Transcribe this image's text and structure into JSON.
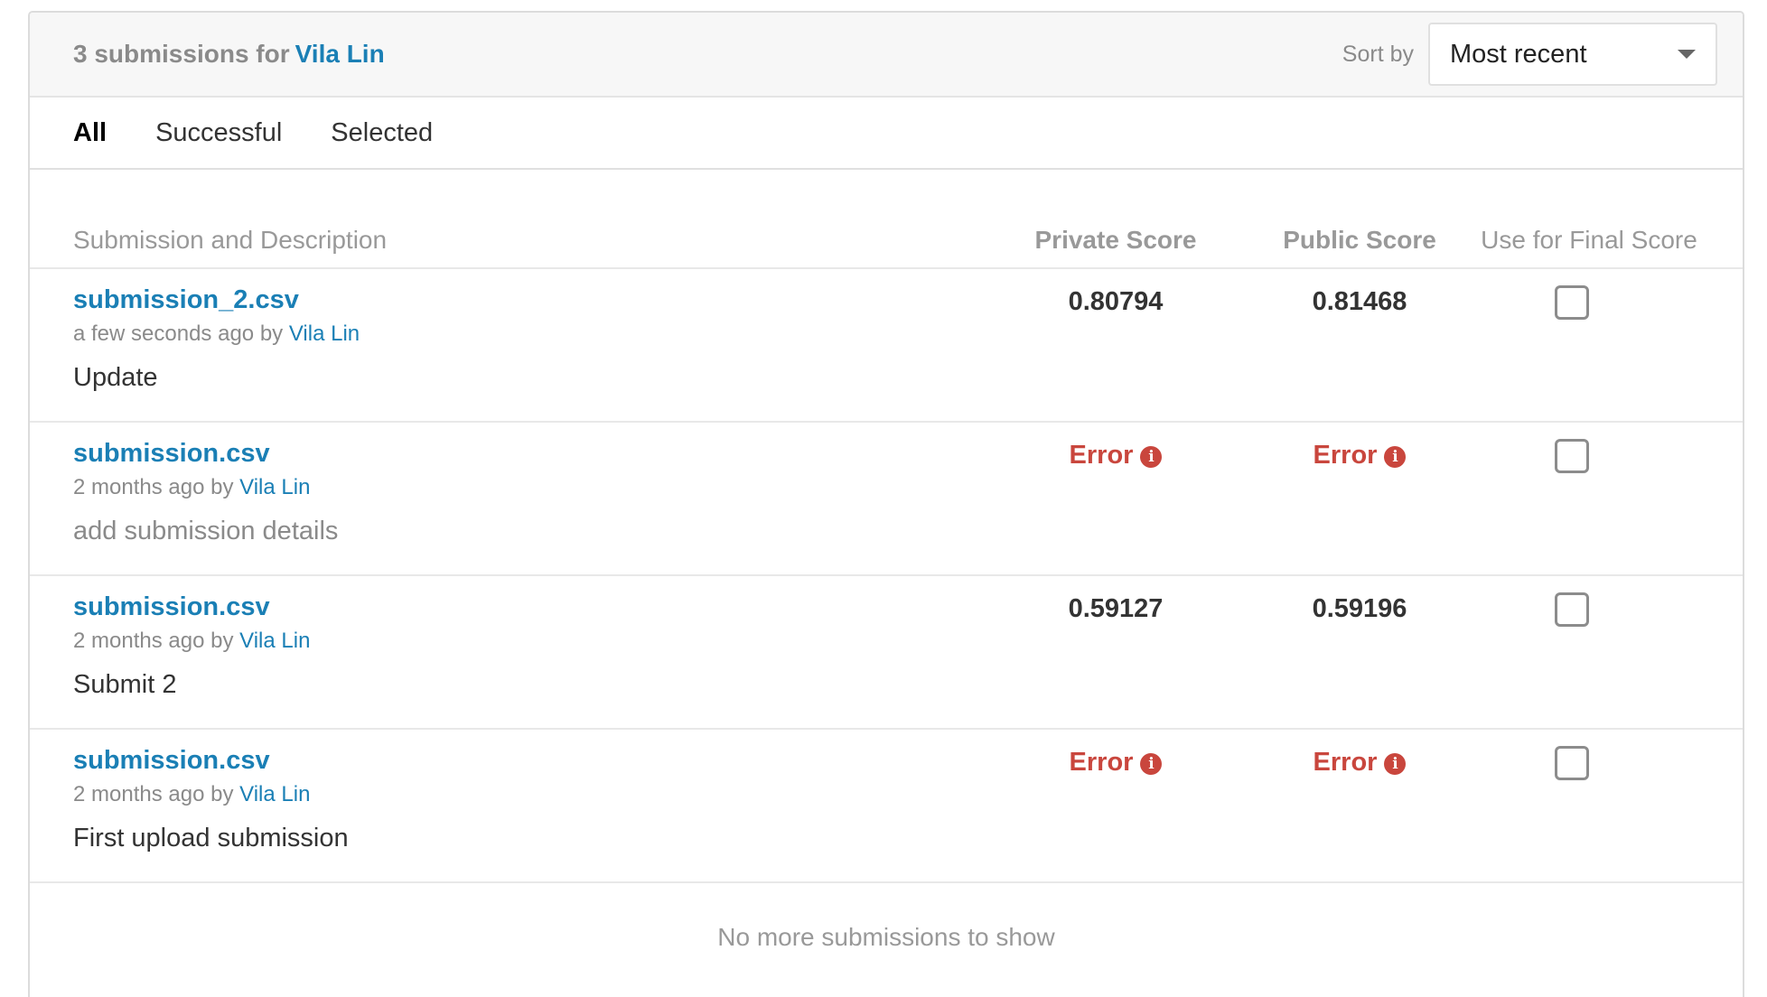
{
  "header": {
    "title": "3 submissions for",
    "user": "Vila Lin",
    "sort_label": "Sort by",
    "sort_value": "Most recent"
  },
  "tabs": [
    {
      "label": "All",
      "active": true
    },
    {
      "label": "Successful",
      "active": false
    },
    {
      "label": "Selected",
      "active": false
    }
  ],
  "columns": {
    "submission": "Submission and Description",
    "private": "Private Score",
    "public": "Public Score",
    "final": "Use for Final Score"
  },
  "rows": [
    {
      "file": "submission_2.csv",
      "time": "a few seconds ago",
      "by": "by",
      "user": "Vila Lin",
      "desc": "Update",
      "private": "0.80794",
      "public": "0.81468",
      "selected": false
    },
    {
      "file": "submission.csv",
      "time": "2 months ago",
      "by": "by",
      "user": "Vila Lin",
      "desc": "add submission details",
      "private": "Error",
      "public": "Error",
      "selected": false
    },
    {
      "file": "submission.csv",
      "time": "2 months ago",
      "by": "by",
      "user": "Vila Lin",
      "desc": "Submit 2",
      "private": "0.59127",
      "public": "0.59196",
      "selected": false
    },
    {
      "file": "submission.csv",
      "time": "2 months ago",
      "by": "by",
      "user": "Vila Lin",
      "desc": "First upload submission",
      "private": "Error",
      "public": "Error",
      "selected": false
    }
  ],
  "footer": "No more submissions to show",
  "colors": {
    "link": "#1a7fb5",
    "error": "#c9463d"
  }
}
